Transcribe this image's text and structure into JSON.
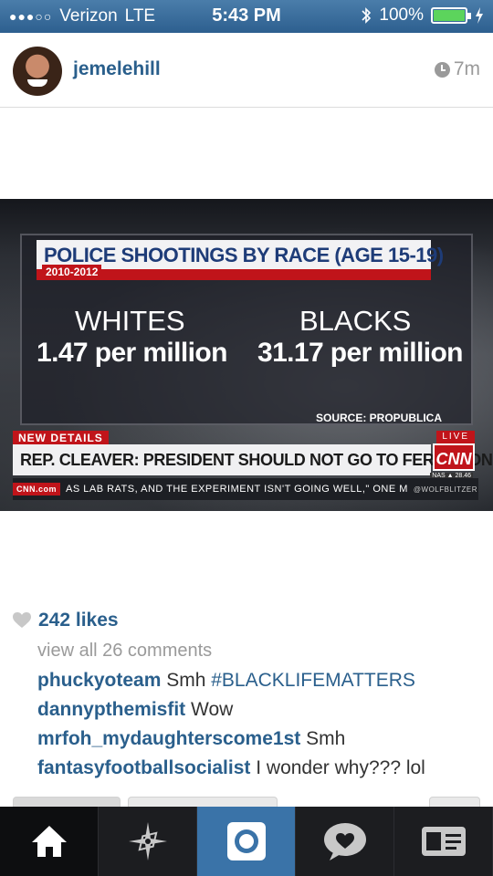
{
  "status_bar": {
    "carrier": "Verizon",
    "network": "LTE",
    "time": "5:43 PM",
    "battery": "100%",
    "signal_dots": "●●●○○"
  },
  "post": {
    "username": "jemelehill",
    "age": "7m"
  },
  "photo": {
    "graphic_title": "POLICE SHOOTINGS BY RACE (AGE 15-19)",
    "graphic_years": "2010-2012",
    "col1_head": "WHITES",
    "col1_value": "1.47 per million",
    "col2_head": "BLACKS",
    "col2_value": "31.17 per million",
    "source": "SOURCE: PROPUBLICA",
    "new_details": "NEW DETAILS",
    "live": "LIVE",
    "headline": "REP. CLEAVER: PRESIDENT SHOULD NOT GO TO FERGUSON",
    "network_logo": "CNN",
    "ticker_logo": "CNN.com",
    "ticker_text": "AS LAB RATS, AND THE EXPERIMENT ISN'T GOING WELL,\" ONE M",
    "ticker_handle": "@WOLFBLITZER",
    "nas": "NAS ▲ 28.46"
  },
  "engagement": {
    "likes": "242 likes",
    "view_all": "view all 26 comments"
  },
  "comments": [
    {
      "user": "phuckyoteam",
      "text": "Smh ",
      "tag": "#BLACKLIFEMATTERS"
    },
    {
      "user": "dannypthemisfit",
      "text": "Wow",
      "tag": ""
    },
    {
      "user": "mrfoh_mydaughterscome1st",
      "text": "Smh",
      "tag": ""
    },
    {
      "user": "fantasyfootballsocialist",
      "text": "I wonder why??? lol",
      "tag": ""
    }
  ],
  "tabs": [
    {
      "icon": "home-icon"
    },
    {
      "icon": "explore-icon"
    },
    {
      "icon": "camera-icon"
    },
    {
      "icon": "activity-icon"
    },
    {
      "icon": "profile-icon"
    }
  ],
  "colors": {
    "link_blue": "#2a5f8c",
    "status_bar": "#3a6d9c",
    "cnn_red": "#c0141a",
    "tab_bar": "#1c1d20",
    "camera_tab": "#3a73a8"
  }
}
